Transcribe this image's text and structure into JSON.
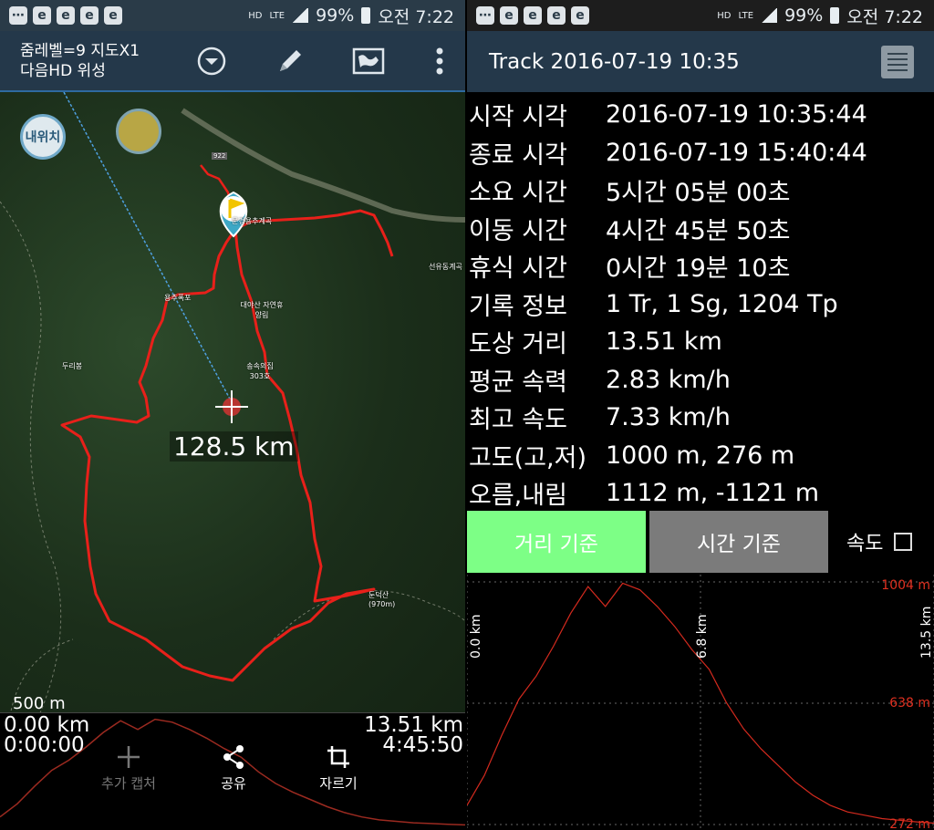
{
  "status_bar": {
    "left_icons": [
      "e",
      "e",
      "e",
      "e",
      "e"
    ],
    "battery": "99%",
    "time": "오전 7:22",
    "hd_label": "HD",
    "lte_label": "LTE"
  },
  "map_screen": {
    "title_line1": "줌레벨=9 지도X1",
    "title_line2": "다음HD 위성",
    "my_location_label": "내위치",
    "distance_label": "128.5 km",
    "scale_label": "500 m",
    "places": [
      {
        "name": "문경용추계곡"
      },
      {
        "name": "용추폭포"
      },
      {
        "name": "대야산 자연휴양림"
      },
      {
        "name": "두리봉"
      },
      {
        "name": "송속의집 303호"
      },
      {
        "name": "둔덕산 (970m)"
      },
      {
        "name": "선유동계곡"
      },
      {
        "name": "922"
      }
    ],
    "profile": {
      "start_distance": "0.00 km",
      "start_time": "0:00:00",
      "end_distance": "13.51 km",
      "end_time": "4:45:50"
    },
    "actions": [
      {
        "label": "추가 캡처",
        "icon": "plus-icon"
      },
      {
        "label": "공유",
        "icon": "share-icon"
      },
      {
        "label": "자르기",
        "icon": "crop-icon"
      }
    ]
  },
  "track_screen": {
    "title": "Track 2016-07-19 10:35",
    "stats": [
      {
        "label": "시작 시각",
        "value": "2016-07-19 10:35:44"
      },
      {
        "label": "종료 시각",
        "value": "2016-07-19 15:40:44"
      },
      {
        "label": "소요 시간",
        "value": "5시간 05분 00초"
      },
      {
        "label": "이동 시간",
        "value": "4시간 45분 50초"
      },
      {
        "label": "휴식 시간",
        "value": "0시간 19분 10초"
      },
      {
        "label": "기록 정보",
        "value": "1 Tr, 1 Sg, 1204 Tp"
      },
      {
        "label": "도상 거리",
        "value": "13.51 km"
      },
      {
        "label": "평균 속력",
        "value": "2.83 km/h"
      },
      {
        "label": "최고 속도",
        "value": "7.33 km/h"
      },
      {
        "label": "고도(고,저)",
        "value": "1000 m, 276 m"
      },
      {
        "label": "오름,내림",
        "value": "1112 m, -1121 m"
      }
    ],
    "tab_distance": "거리 기준",
    "tab_time": "시간 기준",
    "speed_label": "속도",
    "speed_checked": false
  },
  "chart_data": {
    "type": "area",
    "title": "",
    "xlabel": "",
    "ylabel": "",
    "x_ticks": [
      "0.0 km",
      "6.8 km",
      "13.5 km"
    ],
    "y_ticks": [
      "1004 m",
      "638 m",
      "272 m"
    ],
    "xlim": [
      0,
      13.5
    ],
    "ylim": [
      272,
      1004
    ],
    "line_color": "#d42a1e",
    "series": [
      {
        "x": [
          0,
          0.5,
          1.0,
          1.5,
          2.0,
          2.5,
          3.0,
          3.5,
          4.0,
          4.5,
          5.0,
          5.5,
          6.0,
          6.5,
          7.0,
          7.5,
          8.0,
          8.5,
          9.0,
          9.5,
          10.0,
          10.5,
          11.0,
          11.5,
          12.0,
          12.5,
          13.0,
          13.5
        ],
        "values": [
          330,
          420,
          540,
          650,
          720,
          810,
          910,
          990,
          930,
          1000,
          980,
          930,
          870,
          800,
          740,
          640,
          560,
          500,
          450,
          400,
          360,
          330,
          310,
          300,
          290,
          285,
          280,
          276
        ]
      }
    ]
  }
}
